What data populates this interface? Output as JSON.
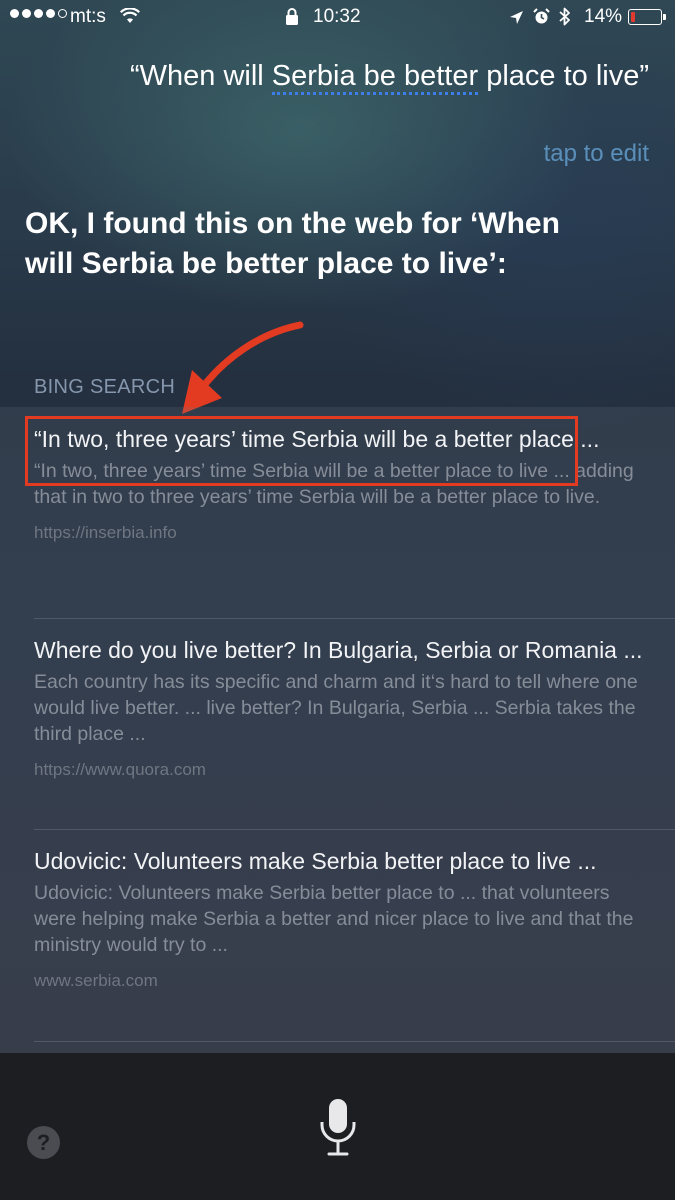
{
  "status_bar": {
    "carrier": "mt:s",
    "time": "10:32",
    "battery_percent": "14%",
    "battery_level": 0.14,
    "signal_bars": 4,
    "icons": [
      "signal-dots-icon",
      "wifi-icon",
      "lock-icon",
      "location-arrow-icon",
      "alarm-icon",
      "bluetooth-icon",
      "battery-icon"
    ]
  },
  "query": {
    "prefix": "“When will ",
    "underlined": "Serbia be better",
    "suffix": " place to live”",
    "tap_to_edit": "tap to edit"
  },
  "reply": {
    "text": "OK, I found this on the web for ‘When will Serbia be better place to live’:"
  },
  "section_label": "BING SEARCH",
  "results": [
    {
      "title": "“In two, three years’ time Serbia will be a better place ...",
      "snippet": "“In two, three years’ time Serbia will be a better place to live ... adding that in two to three years’ time Serbia will be a better place to live.",
      "url": "https://inserbia.info"
    },
    {
      "title": "Where do you live better? In Bulgaria, Serbia or Romania ...",
      "snippet": "Each country has its specific and charm and it‘s hard to tell where one would live better. ... live better? In Bulgaria, Serbia ... Serbia takes the third place ...",
      "url": "https://www.quora.com"
    },
    {
      "title": "Udovicic: Volunteers make Serbia better place to live ...",
      "snippet": "Udovicic: Volunteers make Serbia better place to ... that volunteers were helping make Serbia a better and nicer place to live and that the ministry would try to ...",
      "url": "www.serbia.com"
    }
  ],
  "annotation_color": "#e23b22",
  "bottom_bar": {
    "help_label": "?",
    "icons": [
      "help-icon",
      "microphone-icon"
    ]
  }
}
